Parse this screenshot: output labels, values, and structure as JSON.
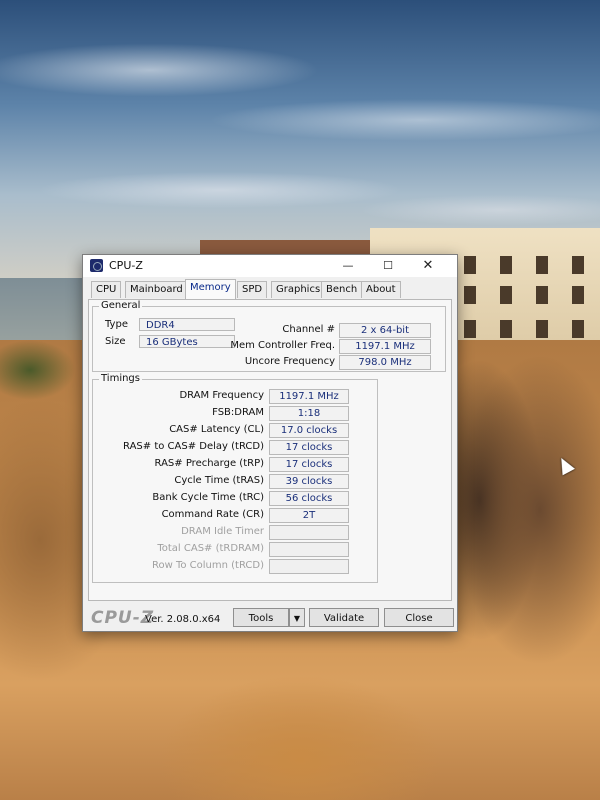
{
  "window": {
    "title": "CPU-Z",
    "controls": {
      "minimize": "—",
      "maximize": "☐",
      "close": "✕"
    }
  },
  "tabs": [
    {
      "label": "CPU"
    },
    {
      "label": "Mainboard"
    },
    {
      "label": "Memory",
      "active": true
    },
    {
      "label": "SPD"
    },
    {
      "label": "Graphics"
    },
    {
      "label": "Bench"
    },
    {
      "label": "About"
    }
  ],
  "general": {
    "title": "General",
    "type_label": "Type",
    "type_value": "DDR4",
    "size_label": "Size",
    "size_value": "16 GBytes",
    "channel_label": "Channel #",
    "channel_value": "2 x 64-bit",
    "mc_freq_label": "Mem Controller Freq.",
    "mc_freq_value": "1197.1 MHz",
    "uncore_label": "Uncore Frequency",
    "uncore_value": "798.0 MHz"
  },
  "timings": {
    "title": "Timings",
    "rows": [
      {
        "label": "DRAM Frequency",
        "value": "1197.1 MHz"
      },
      {
        "label": "FSB:DRAM",
        "value": "1:18"
      },
      {
        "label": "CAS# Latency (CL)",
        "value": "17.0 clocks"
      },
      {
        "label": "RAS# to CAS# Delay (tRCD)",
        "value": "17 clocks"
      },
      {
        "label": "RAS# Precharge (tRP)",
        "value": "17 clocks"
      },
      {
        "label": "Cycle Time (tRAS)",
        "value": "39 clocks"
      },
      {
        "label": "Bank Cycle Time (tRC)",
        "value": "56 clocks"
      },
      {
        "label": "Command Rate (CR)",
        "value": "2T"
      },
      {
        "label": "DRAM Idle Timer",
        "value": ""
      },
      {
        "label": "Total CAS# (tRDRAM)",
        "value": ""
      },
      {
        "label": "Row To Column (tRCD)",
        "value": ""
      }
    ]
  },
  "footer": {
    "brand": "CPU-Z",
    "version": "Ver. 2.08.0.x64",
    "tools_label": "Tools",
    "tools_arrow": "▼",
    "validate_label": "Validate",
    "close_label": "Close"
  }
}
